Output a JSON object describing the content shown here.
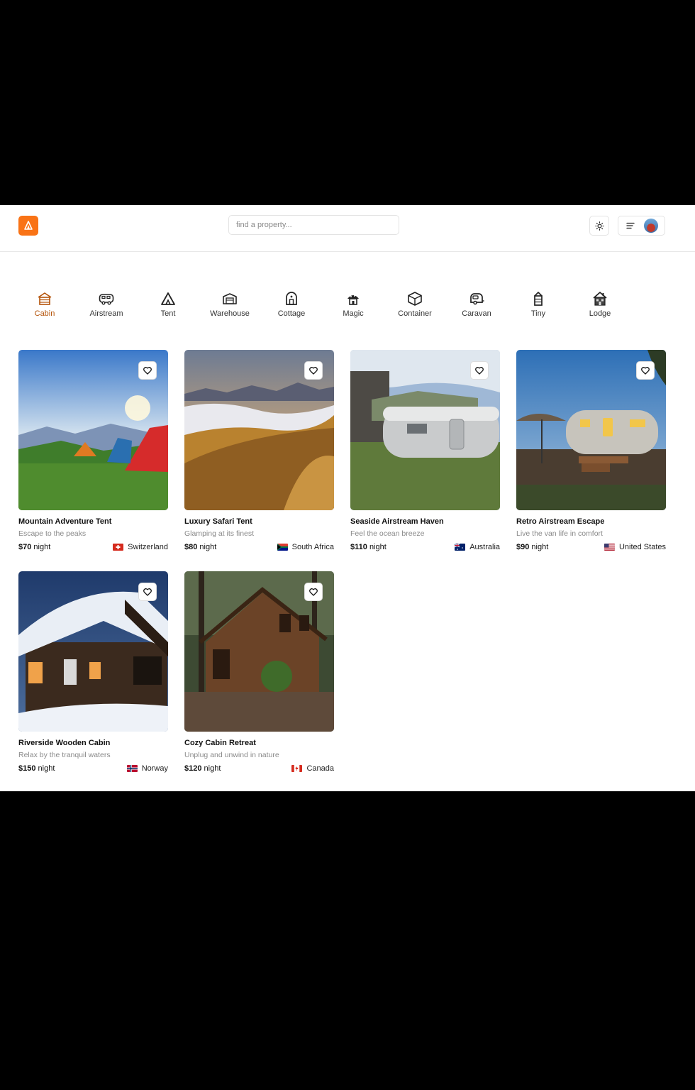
{
  "header": {
    "search_placeholder": "find a property..."
  },
  "categories": [
    {
      "label": "Cabin",
      "icon": "cabin-icon"
    },
    {
      "label": "Airstream",
      "icon": "airstream-icon"
    },
    {
      "label": "Tent",
      "icon": "tent-icon"
    },
    {
      "label": "Warehouse",
      "icon": "warehouse-icon"
    },
    {
      "label": "Cottage",
      "icon": "cottage-icon"
    },
    {
      "label": "Magic",
      "icon": "magic-icon"
    },
    {
      "label": "Container",
      "icon": "container-icon"
    },
    {
      "label": "Caravan",
      "icon": "caravan-icon"
    },
    {
      "label": "Tiny",
      "icon": "tiny-house-icon"
    },
    {
      "label": "Lodge",
      "icon": "lodge-icon"
    }
  ],
  "properties": [
    {
      "title": "Mountain Adventure Tent",
      "tagline": "Escape to the peaks",
      "price": "$70",
      "unit": "night",
      "country": "Switzerland"
    },
    {
      "title": "Luxury Safari Tent",
      "tagline": "Glamping at its finest",
      "price": "$80",
      "unit": "night",
      "country": "South Africa"
    },
    {
      "title": "Seaside Airstream Haven",
      "tagline": "Feel the ocean breeze",
      "price": "$110",
      "unit": "night",
      "country": "Australia"
    },
    {
      "title": "Retro Airstream Escape",
      "tagline": "Live the van life in comfort",
      "price": "$90",
      "unit": "night",
      "country": "United States"
    },
    {
      "title": "Riverside Wooden Cabin",
      "tagline": "Relax by the tranquil waters",
      "price": "$150",
      "unit": "night",
      "country": "Norway"
    },
    {
      "title": "Cozy Cabin Retreat",
      "tagline": "Unplug and unwind in nature",
      "price": "$120",
      "unit": "night",
      "country": "Canada"
    }
  ],
  "colors": {
    "accent": "#f97316",
    "active_category": "#b45309"
  }
}
